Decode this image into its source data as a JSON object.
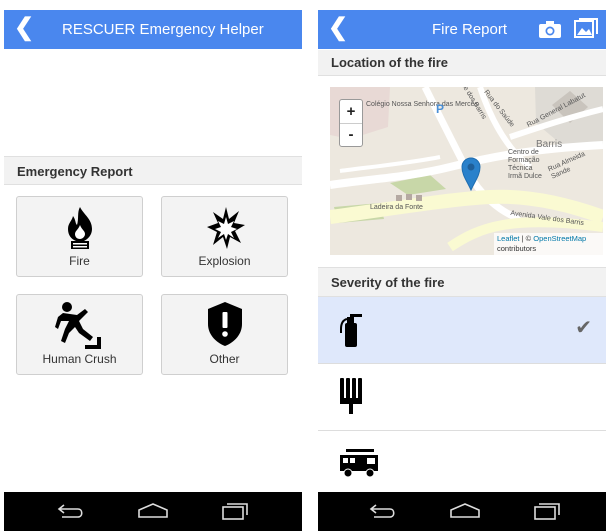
{
  "left_screen": {
    "appbar": {
      "title": "RESCUER Emergency Helper"
    },
    "section_header": "Emergency Report",
    "tiles": [
      {
        "label": "Fire",
        "icon": "fire-icon"
      },
      {
        "label": "Explosion",
        "icon": "explosion-icon"
      },
      {
        "label": "Human Crush",
        "icon": "human-crush-icon"
      },
      {
        "label": "Other",
        "icon": "other-shield-icon"
      }
    ]
  },
  "right_screen": {
    "appbar": {
      "title": "Fire Report",
      "actions": [
        "camera-icon",
        "gallery-icon"
      ]
    },
    "location_header": "Location of the fire",
    "map": {
      "zoom_in": "+",
      "zoom_out": "-",
      "attribution_link1": "Leaflet",
      "attribution_sep": " | © ",
      "attribution_link2": "OpenStreetMap",
      "attribution_text": "contributors",
      "labels": {
        "colegio": "Colégio Nossa Senhora das Mercês",
        "parking": "P",
        "vale_barris": "Vale dos Barris",
        "rua_saude": "Rua do Saúde",
        "rua_general": "Rua General Labatut",
        "barris": "Barris",
        "centro": "Centro de Formação Técnica Irmã Dulce",
        "rua_almeida": "Rua Almeida Sande",
        "ladeira": "Ladeira da Fonte",
        "avenida": "Avenida Vale dos Barris"
      }
    },
    "severity_header": "Severity of the fire",
    "severity_options": [
      {
        "icon": "fire-extinguisher-icon",
        "selected": true,
        "check": "✔"
      },
      {
        "icon": "fire-hose-icon",
        "selected": false
      },
      {
        "icon": "fire-truck-icon",
        "selected": false
      }
    ]
  },
  "nav_bar": {
    "buttons": [
      "back-nav-icon",
      "home-nav-icon",
      "recents-nav-icon"
    ]
  },
  "colors": {
    "appbar": "#4a87ee",
    "selected_row": "#dfe8fb",
    "marker": "#2a81cb"
  }
}
